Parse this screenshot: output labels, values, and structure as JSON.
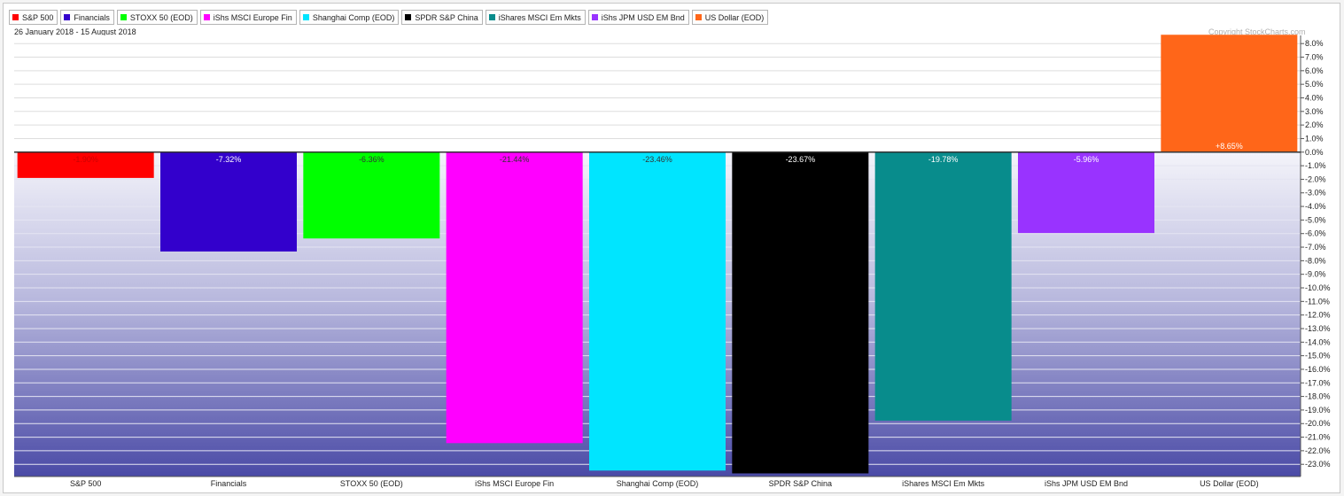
{
  "header": {
    "date_range": "26 January 2018 - 15 August 2018",
    "copyright": "Copyright StockCharts.com"
  },
  "legend": [
    {
      "label": "S&P 500",
      "color": "#ff0000"
    },
    {
      "label": "Financials",
      "color": "#3300cc"
    },
    {
      "label": "STOXX 50 (EOD)",
      "color": "#00ff00"
    },
    {
      "label": "iShs MSCI Europe Fin",
      "color": "#ff00ff"
    },
    {
      "label": "Shanghai Comp (EOD)",
      "color": "#00e5ff"
    },
    {
      "label": "SPDR S&P China",
      "color": "#000000"
    },
    {
      "label": "iShares MSCI Em Mkts",
      "color": "#088c8c"
    },
    {
      "label": "iShs JPM USD EM Bnd",
      "color": "#9933ff"
    },
    {
      "label": "US Dollar (EOD)",
      "color": "#ff6619"
    }
  ],
  "chart_data": {
    "type": "bar",
    "categories": [
      "S&P 500",
      "Financials",
      "STOXX 50 (EOD)",
      "iShs MSCI Europe Fin",
      "Shanghai Comp (EOD)",
      "SPDR S&P China",
      "iShares MSCI Em Mkts",
      "iShs JPM USD EM Bnd",
      "US Dollar (EOD)"
    ],
    "values": [
      -1.9,
      -7.32,
      -6.36,
      -21.44,
      -23.46,
      -23.67,
      -19.78,
      -5.96,
      8.65
    ],
    "value_labels": [
      "-1.90%",
      "-7.32%",
      "-6.36%",
      "-21.44%",
      "-23.46%",
      "-23.67%",
      "-19.78%",
      "-5.96%",
      "+8.65%"
    ],
    "colors": [
      "#ff0000",
      "#3300cc",
      "#00ff00",
      "#ff00ff",
      "#00e5ff",
      "#000000",
      "#088c8c",
      "#9933ff",
      "#ff6619"
    ],
    "label_colors": [
      "#cc0000",
      "#ffffff",
      "#333333",
      "#333333",
      "#333333",
      "#ffffff",
      "#ffffff",
      "#ffffff",
      "#ffffff"
    ],
    "y_ticks": [
      8,
      7,
      6,
      5,
      4,
      3,
      2,
      1,
      0,
      -1,
      -2,
      -3,
      -4,
      -5,
      -6,
      -7,
      -8,
      -9,
      -10,
      -11,
      -12,
      -13,
      -14,
      -15,
      -16,
      -17,
      -18,
      -19,
      -20,
      -21,
      -22,
      -23
    ],
    "y_tick_labels": [
      "8.0%",
      "7.0%",
      "6.0%",
      "5.0%",
      "4.0%",
      "3.0%",
      "2.0%",
      "1.0%",
      "0.0%",
      "-1.0%",
      "-2.0%",
      "-3.0%",
      "-4.0%",
      "-5.0%",
      "-6.0%",
      "-7.0%",
      "-8.0%",
      "-9.0%",
      "-10.0%",
      "-11.0%",
      "-12.0%",
      "-13.0%",
      "-14.0%",
      "-15.0%",
      "-16.0%",
      "-17.0%",
      "-18.0%",
      "-19.0%",
      "-20.0%",
      "-21.0%",
      "-22.0%",
      "-23.0%"
    ],
    "ylim": [
      -23.9,
      8.6
    ],
    "grid": true,
    "legend_position": "top-left"
  }
}
